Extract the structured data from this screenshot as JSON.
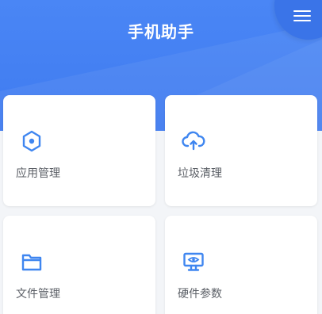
{
  "app": {
    "title": "手机助手"
  },
  "header": {
    "menu_icon": "hamburger-menu-icon"
  },
  "cards": [
    {
      "label": "应用管理",
      "icon": "hexagon-app-icon"
    },
    {
      "label": "垃圾清理",
      "icon": "cloud-upload-icon"
    },
    {
      "label": "文件管理",
      "icon": "folder-icon"
    },
    {
      "label": "硬件参数",
      "icon": "monitor-eye-icon"
    }
  ],
  "colors": {
    "header_blue": "#4a86f5",
    "accent_blue": "#3f86f0",
    "card_bg": "#ffffff",
    "page_bg": "#f3f5f8",
    "label_gray": "#5b5f66"
  }
}
